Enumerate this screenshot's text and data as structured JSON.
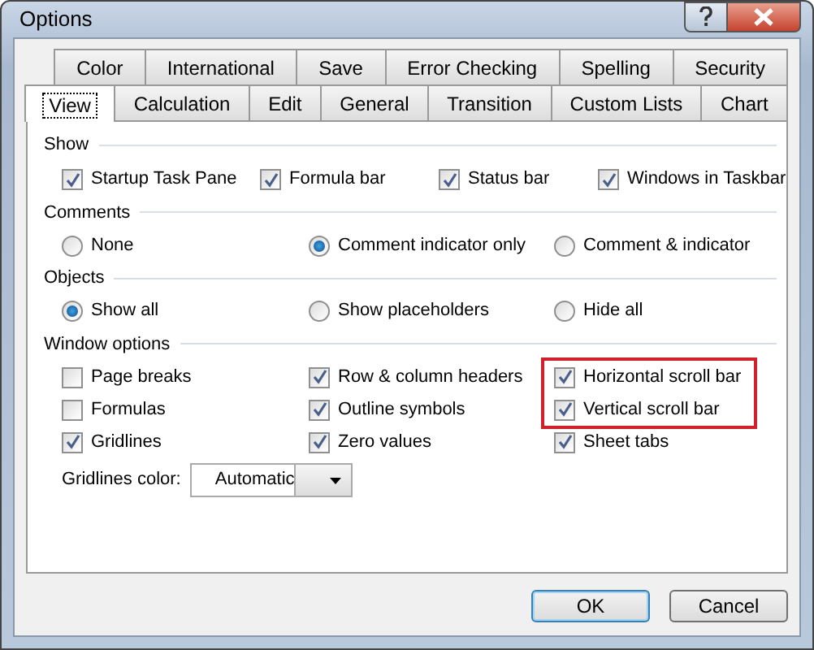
{
  "window": {
    "title": "Options"
  },
  "tab_rows": [
    [
      {
        "label": "Color",
        "selected": false
      },
      {
        "label": "International",
        "selected": false
      },
      {
        "label": "Save",
        "selected": false
      },
      {
        "label": "Error Checking",
        "selected": false
      },
      {
        "label": "Spelling",
        "selected": false
      },
      {
        "label": "Security",
        "selected": false
      }
    ],
    [
      {
        "label": "View",
        "selected": true
      },
      {
        "label": "Calculation",
        "selected": false
      },
      {
        "label": "Edit",
        "selected": false
      },
      {
        "label": "General",
        "selected": false
      },
      {
        "label": "Transition",
        "selected": false
      },
      {
        "label": "Custom Lists",
        "selected": false
      },
      {
        "label": "Chart",
        "selected": false
      }
    ]
  ],
  "show": {
    "title": "Show",
    "items": [
      {
        "label": "Startup Task Pane",
        "checked": true
      },
      {
        "label": "Formula bar",
        "checked": true
      },
      {
        "label": "Status bar",
        "checked": true
      },
      {
        "label": "Windows in Taskbar",
        "checked": true
      }
    ]
  },
  "comments": {
    "title": "Comments",
    "items": [
      {
        "label": "None",
        "selected": false
      },
      {
        "label": "Comment indicator only",
        "selected": true
      },
      {
        "label": "Comment & indicator",
        "selected": false
      }
    ]
  },
  "objects": {
    "title": "Objects",
    "items": [
      {
        "label": "Show all",
        "selected": true
      },
      {
        "label": "Show placeholders",
        "selected": false
      },
      {
        "label": "Hide all",
        "selected": false
      }
    ]
  },
  "window_options": {
    "title": "Window options",
    "columns": [
      [
        {
          "label": "Page breaks",
          "checked": false,
          "highlighted": false
        },
        {
          "label": "Formulas",
          "checked": false,
          "highlighted": false
        },
        {
          "label": "Gridlines",
          "checked": true,
          "highlighted": false
        }
      ],
      [
        {
          "label": "Row & column headers",
          "checked": true,
          "highlighted": false
        },
        {
          "label": "Outline symbols",
          "checked": true,
          "highlighted": false
        },
        {
          "label": "Zero values",
          "checked": true,
          "highlighted": false
        }
      ],
      [
        {
          "label": "Horizontal scroll bar",
          "checked": true,
          "highlighted": true
        },
        {
          "label": "Vertical scroll bar",
          "checked": true,
          "highlighted": true
        },
        {
          "label": "Sheet tabs",
          "checked": true,
          "highlighted": false
        }
      ]
    ],
    "gridlines_color": {
      "label": "Gridlines color:",
      "value": "Automatic"
    }
  },
  "buttons": [
    {
      "label": "OK",
      "default": true
    },
    {
      "label": "Cancel",
      "default": false
    }
  ]
}
